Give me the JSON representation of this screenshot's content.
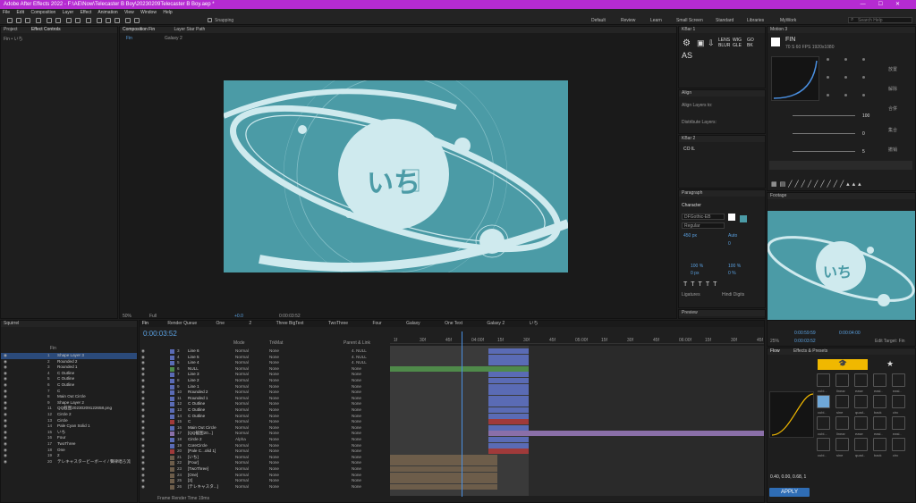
{
  "title": "Adobe After Effects 2022 - F:\\AE\\Now\\Telecaster B Boy\\20230209Telecaster B Boy.aep *",
  "menu": [
    "File",
    "Edit",
    "Composition",
    "Layer",
    "Effect",
    "Animation",
    "View",
    "Window",
    "Help"
  ],
  "workspaces": [
    "Default",
    "Review",
    "Learn",
    "Small Screen",
    "Standard",
    "Libraries",
    "MyWork"
  ],
  "search_placeholder": "Search Help",
  "snapping": "Snapping",
  "project": {
    "tab": "Project",
    "effect_tab": "Effect Controls",
    "effect_sub": "Fin • いち"
  },
  "comp": {
    "tab": "Composition Fin",
    "sub_fin": "Fin",
    "sub_galaxy": "Galaxy 2",
    "layer_tab": "Layer Star Path",
    "zoom": "50%",
    "quality": "Full",
    "time": "0:00:03:52",
    "cam": "+0.0",
    "canvas_text": "いち"
  },
  "kbar": {
    "title": "KBar 1",
    "labels": [
      "LENS",
      "WIG",
      "GO",
      "BLUR",
      "GLE",
      "BK"
    ],
    "as": "AS"
  },
  "align": {
    "title": "Align",
    "align_to": "Align Layers to:",
    "dist": "Distribute Layers:"
  },
  "kbar2": {
    "title": "KBar 2",
    "text": "CO IL"
  },
  "paragraph": "Paragraph",
  "character": {
    "title": "Character",
    "font": "DFGothic-EB",
    "style": "Regular",
    "size": "450 px",
    "leading": "Auto",
    "tracking": "0",
    "scale_v": "100 %",
    "scale_h": "100 %",
    "baseline": "0 px",
    "tsume": "0 %",
    "ligatures": "Ligatures",
    "hindi": "Hindi Digits"
  },
  "preview": "Preview",
  "motion": {
    "title": "Motion 3",
    "fin": "FIN",
    "fps": "70 S   60 FPS   1920x1080",
    "v100": "100",
    "v0": "0",
    "v5": "5",
    "labels": [
      "放置",
      "解除",
      "合併",
      "集合",
      "撤销"
    ]
  },
  "footage": {
    "tab": "Footage",
    "canvas_text": "いち"
  },
  "timeline": {
    "time": "0:00:03:52",
    "tabs": [
      "Fin",
      "Render Queue",
      "One",
      "2",
      "Three BigText",
      "TwoThree",
      "Four",
      "Galaxy",
      "One Text",
      "Galaxy 2",
      "いち"
    ],
    "ticks": [
      "1f",
      "30f",
      "45f",
      "04:00f",
      "15f",
      "30f",
      "45f",
      "05:00f",
      "15f",
      "30f",
      "45f",
      "06:00f",
      "15f",
      "30f",
      "45f"
    ],
    "cols": {
      "mode": "Mode",
      "trkmat": "TrkMat",
      "parent": "Parent & Link"
    },
    "footer": "Frame Render Time 19ms"
  },
  "squirrel": {
    "title": "Squirrel",
    "comp": "Fin",
    "layers": [
      {
        "n": "1",
        "name": "Shape Layer 3",
        "sel": true
      },
      {
        "n": "2",
        "name": "Rounded 2"
      },
      {
        "n": "3",
        "name": "Rounded 1"
      },
      {
        "n": "4",
        "name": "C Outline"
      },
      {
        "n": "5",
        "name": "C Outline"
      },
      {
        "n": "6",
        "name": "C Outline"
      },
      {
        "n": "7",
        "name": "C"
      },
      {
        "n": "8",
        "name": "Main Out Circle"
      },
      {
        "n": "9",
        "name": "Shape Layer 2"
      },
      {
        "n": "11",
        "name": "QQ截图20230209122658.png"
      },
      {
        "n": "12",
        "name": "Circle 2"
      },
      {
        "n": "13",
        "name": "Circle"
      },
      {
        "n": "14",
        "name": "Pale Cyan Solid 1"
      },
      {
        "n": "15",
        "name": "いち"
      },
      {
        "n": "16",
        "name": "Four"
      },
      {
        "n": "17",
        "name": "TwoThree"
      },
      {
        "n": "18",
        "name": "One"
      },
      {
        "n": "19",
        "name": "2"
      },
      {
        "n": "20",
        "name": "テレキャスタービーボーイ / 聲律唱ろ流"
      }
    ]
  },
  "layers": [
    {
      "n": "3",
      "name": "Line 6",
      "c": "#5a6bb5",
      "mode": "Normal",
      "parent": "4. NULL"
    },
    {
      "n": "4",
      "name": "Line 5",
      "c": "#5a6bb5",
      "mode": "Normal",
      "parent": "4. NULL"
    },
    {
      "n": "5",
      "name": "Line 4",
      "c": "#5a6bb5",
      "mode": "Normal",
      "parent": "4. NULL"
    },
    {
      "n": "6",
      "name": "NULL",
      "c": "#4f8a4a",
      "mode": "Normal",
      "parent": "None"
    },
    {
      "n": "7",
      "name": "Line 3",
      "c": "#5a6bb5",
      "mode": "Normal",
      "parent": "None"
    },
    {
      "n": "8",
      "name": "Line 2",
      "c": "#5a6bb5",
      "mode": "Normal",
      "parent": "None"
    },
    {
      "n": "9",
      "name": "Line 1",
      "c": "#5a6bb5",
      "mode": "Normal",
      "parent": "None"
    },
    {
      "n": "10",
      "name": "Rounded 2",
      "c": "#5a6bb5",
      "mode": "Normal",
      "parent": "None"
    },
    {
      "n": "11",
      "name": "Rounded 1",
      "c": "#5a6bb5",
      "mode": "Normal",
      "parent": "None"
    },
    {
      "n": "12",
      "name": "C Outline",
      "c": "#5a6bb5",
      "mode": "Normal",
      "parent": "None"
    },
    {
      "n": "13",
      "name": "C Outline",
      "c": "#5a6bb5",
      "mode": "Normal",
      "parent": "None"
    },
    {
      "n": "14",
      "name": "C Outline",
      "c": "#5a6bb5",
      "mode": "Normal",
      "parent": "None"
    },
    {
      "n": "15",
      "name": "C",
      "c": "#a03a3a",
      "mode": "Normal",
      "parent": "None"
    },
    {
      "n": "16",
      "name": "Main Out Circle",
      "c": "#5a6bb5",
      "mode": "Normal",
      "parent": "None"
    },
    {
      "n": "17",
      "name": "[QQ截图20...]",
      "c": "#8a6fa8",
      "mode": "Normal",
      "parent": "None"
    },
    {
      "n": "18",
      "name": "Circle 2",
      "c": "#5a6bb5",
      "mode": "Alpha",
      "parent": "None"
    },
    {
      "n": "19",
      "name": "CoreCircle",
      "c": "#5a6bb5",
      "mode": "Normal",
      "parent": "None"
    },
    {
      "n": "20",
      "name": "[Pale C...olid 1]",
      "c": "#a03a3a",
      "mode": "Normal",
      "parent": "None"
    },
    {
      "n": "21",
      "name": "[いち]",
      "c": "#6d5d4a",
      "mode": "Normal",
      "parent": "None"
    },
    {
      "n": "22",
      "name": "[Four]",
      "c": "#6d5d4a",
      "mode": "Normal",
      "parent": "None"
    },
    {
      "n": "23",
      "name": "[TwoThree]",
      "c": "#6d5d4a",
      "mode": "Normal",
      "parent": "None"
    },
    {
      "n": "24",
      "name": "[One]",
      "c": "#6d5d4a",
      "mode": "Normal",
      "parent": "None"
    },
    {
      "n": "25",
      "name": "[2]",
      "c": "#6d5d4a",
      "mode": "Normal",
      "parent": "None"
    },
    {
      "n": "26",
      "name": "[テレキャスタ...]",
      "c": "#6d5d4a",
      "mode": "Normal",
      "parent": "None"
    }
  ],
  "fx": {
    "tab_flow": "Flow",
    "tab_presets": "Effects & Presets",
    "values": "0.40, 0.00, 0.68, 1",
    "apply": "APPLY",
    "labels": [
      "cubi...",
      "linear",
      "ease",
      "easi..",
      "easi..",
      "cubi..",
      "sine",
      "quad..",
      "back",
      "circ"
    ]
  },
  "right_time": {
    "t1": "0:00:59:59",
    "t2": "0:00:04:00",
    "zoom": "25%",
    "edit": "Edit Target: Fin",
    "end": "0:00:03:52"
  }
}
